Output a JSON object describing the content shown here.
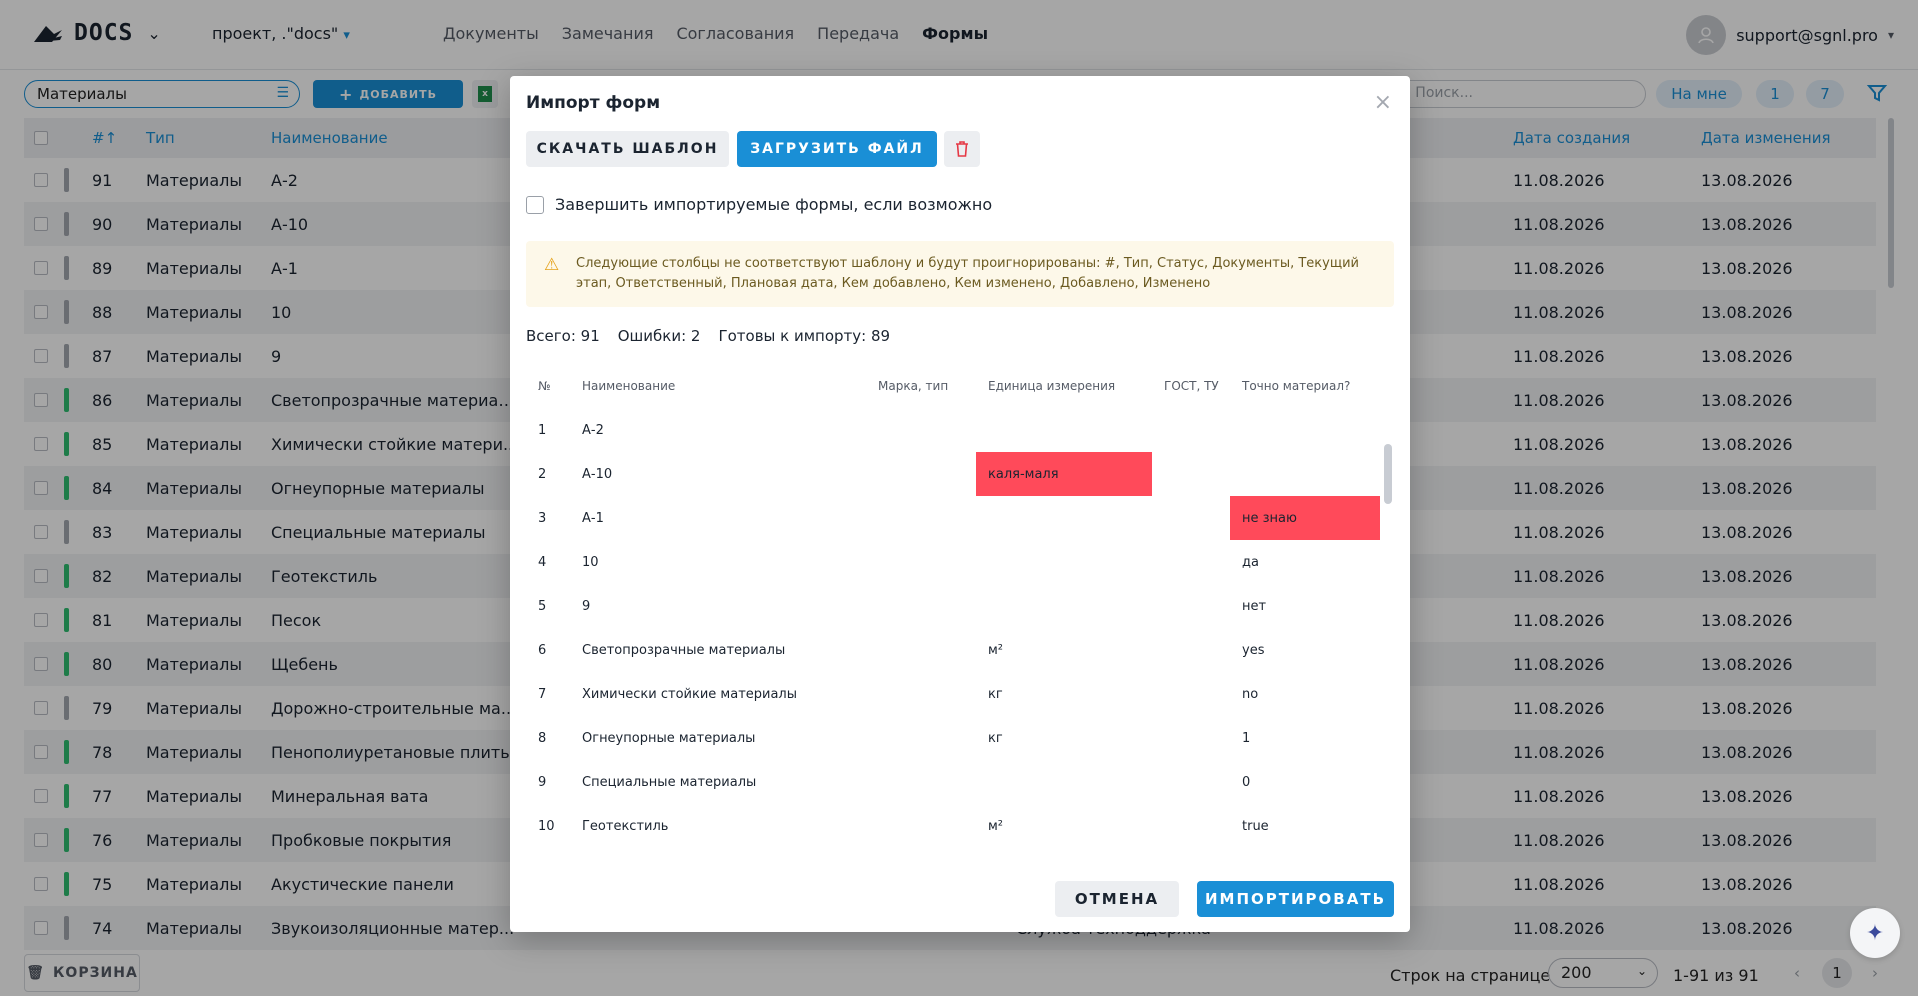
{
  "header": {
    "logo": "DOCS",
    "project": "проект, .\"docs\"",
    "nav": [
      "Документы",
      "Замечания",
      "Согласования",
      "Передача",
      "Формы"
    ],
    "active_nav": "Формы",
    "user": "support@sgnl.pro"
  },
  "toolbar": {
    "filter_value": "Материалы",
    "add_label": "ДОБАВИТЬ",
    "search_placeholder": "Поиск...",
    "on_me_label": "На мне",
    "count_1": "1",
    "count_7": "7"
  },
  "table": {
    "headers": [
      "#↑",
      "Тип",
      "Наименование",
      "Дата создания",
      "Дата изменения"
    ],
    "visible_right_text": "ка",
    "rows": [
      {
        "num": "91",
        "type": "Материалы",
        "name": "А-2",
        "status": "s",
        "created": "11.08.2026",
        "modified": "13.08.2026"
      },
      {
        "num": "90",
        "type": "Материалы",
        "name": "А-10",
        "status": "s",
        "created": "11.08.2026",
        "modified": "13.08.2026"
      },
      {
        "num": "89",
        "type": "Материалы",
        "name": "А-1",
        "status": "s",
        "created": "11.08.2026",
        "modified": "13.08.2026"
      },
      {
        "num": "88",
        "type": "Материалы",
        "name": "10",
        "status": "s",
        "created": "11.08.2026",
        "modified": "13.08.2026"
      },
      {
        "num": "87",
        "type": "Материалы",
        "name": "9",
        "status": "s",
        "created": "11.08.2026",
        "modified": "13.08.2026"
      },
      {
        "num": "86",
        "type": "Материалы",
        "name": "Светопрозрачные материал...",
        "status": "g",
        "created": "11.08.2026",
        "modified": "13.08.2026"
      },
      {
        "num": "85",
        "type": "Материалы",
        "name": "Химически стойкие матери...",
        "status": "g",
        "created": "11.08.2026",
        "modified": "13.08.2026"
      },
      {
        "num": "84",
        "type": "Материалы",
        "name": "Огнеупорные материалы",
        "status": "g",
        "created": "11.08.2026",
        "modified": "13.08.2026"
      },
      {
        "num": "83",
        "type": "Материалы",
        "name": "Специальные материалы",
        "status": "s",
        "created": "11.08.2026",
        "modified": "13.08.2026"
      },
      {
        "num": "82",
        "type": "Материалы",
        "name": "Геотекстиль",
        "status": "g",
        "created": "11.08.2026",
        "modified": "13.08.2026"
      },
      {
        "num": "81",
        "type": "Материалы",
        "name": "Песок",
        "status": "g",
        "created": "11.08.2026",
        "modified": "13.08.2026"
      },
      {
        "num": "80",
        "type": "Материалы",
        "name": "Щебень",
        "status": "g",
        "created": "11.08.2026",
        "modified": "13.08.2026"
      },
      {
        "num": "79",
        "type": "Материалы",
        "name": "Дорожно-строительные ма...",
        "status": "s",
        "created": "11.08.2026",
        "modified": "13.08.2026"
      },
      {
        "num": "78",
        "type": "Материалы",
        "name": "Пенополиуретановые плиты",
        "status": "g",
        "created": "11.08.2026",
        "modified": "13.08.2026"
      },
      {
        "num": "77",
        "type": "Материалы",
        "name": "Минеральная вата",
        "status": "g",
        "created": "11.08.2026",
        "modified": "13.08.2026"
      },
      {
        "num": "76",
        "type": "Материалы",
        "name": "Пробковые покрытия",
        "status": "g",
        "created": "11.08.2026",
        "modified": "13.08.2026"
      },
      {
        "num": "75",
        "type": "Материалы",
        "name": "Акустические панели",
        "status": "g",
        "created": "11.08.2026",
        "modified": "13.08.2026"
      },
      {
        "num": "74",
        "type": "Материалы",
        "name": "Звукоизоляционные матер...",
        "status": "s",
        "created": "11.08.2026",
        "modified": "13.08.2026"
      }
    ],
    "last_row_mid_text": "Служба техподдержка"
  },
  "footer": {
    "trash_label": "КОРЗИНА",
    "rows_per_page_label": "Строк на странице",
    "rows_per_page": "200",
    "range": "1-91 из 91",
    "page": "1"
  },
  "modal": {
    "title": "Импорт форм",
    "download_template": "СКАЧАТЬ ШАБЛОН",
    "upload_file": "ЗАГРУЗИТЬ ФАЙЛ",
    "complete_label": "Завершить импортируемые формы, если возможно",
    "warning": "Следующие столбцы не соответствуют шаблону и будут проигнорированы: #, Тип, Статус, Документы, Текущий этап, Ответственный, Плановая дата, Кем добавлено, Кем изменено, Добавлено, Изменено",
    "stats": {
      "total": "Всего: 91",
      "errors": "Ошибки: 2",
      "ready": "Готовы к импорту: 89"
    },
    "columns": [
      "№",
      "Наименование",
      "Марка, тип",
      "Единица измерения",
      "ГОСТ, ТУ",
      "Точно материал?"
    ],
    "rows": [
      {
        "n": "1",
        "name": "А-2",
        "brand": "",
        "unit": "",
        "gost": "",
        "exact": "",
        "err_unit": false,
        "err_exact": false
      },
      {
        "n": "2",
        "name": "А-10",
        "brand": "",
        "unit": "каля-маля",
        "gost": "",
        "exact": "",
        "err_unit": true,
        "err_exact": false
      },
      {
        "n": "3",
        "name": "А-1",
        "brand": "",
        "unit": "",
        "gost": "",
        "exact": "не знаю",
        "err_unit": false,
        "err_exact": true
      },
      {
        "n": "4",
        "name": "10",
        "brand": "",
        "unit": "",
        "gost": "",
        "exact": "да",
        "err_unit": false,
        "err_exact": false
      },
      {
        "n": "5",
        "name": "9",
        "brand": "",
        "unit": "",
        "gost": "",
        "exact": "нет",
        "err_unit": false,
        "err_exact": false
      },
      {
        "n": "6",
        "name": "Светопрозрачные материалы",
        "brand": "",
        "unit": "м²",
        "gost": "",
        "exact": "yes",
        "err_unit": false,
        "err_exact": false
      },
      {
        "n": "7",
        "name": "Химически стойкие материалы",
        "brand": "",
        "unit": "кг",
        "gost": "",
        "exact": "no",
        "err_unit": false,
        "err_exact": false
      },
      {
        "n": "8",
        "name": "Огнеупорные материалы",
        "brand": "",
        "unit": "кг",
        "gost": "",
        "exact": "1",
        "err_unit": false,
        "err_exact": false
      },
      {
        "n": "9",
        "name": "Специальные материалы",
        "brand": "",
        "unit": "",
        "gost": "",
        "exact": "0",
        "err_unit": false,
        "err_exact": false
      },
      {
        "n": "10",
        "name": "Геотекстиль",
        "brand": "",
        "unit": "м²",
        "gost": "",
        "exact": "true",
        "err_unit": false,
        "err_exact": false
      }
    ],
    "cancel": "ОТМЕНА",
    "import": "ИМПОРТИРОВАТЬ"
  },
  "colors": {
    "accent": "#1a8fd6",
    "error": "#ff4a5a",
    "status_green": "#2fbf71",
    "status_gray": "#a4a8b0"
  }
}
